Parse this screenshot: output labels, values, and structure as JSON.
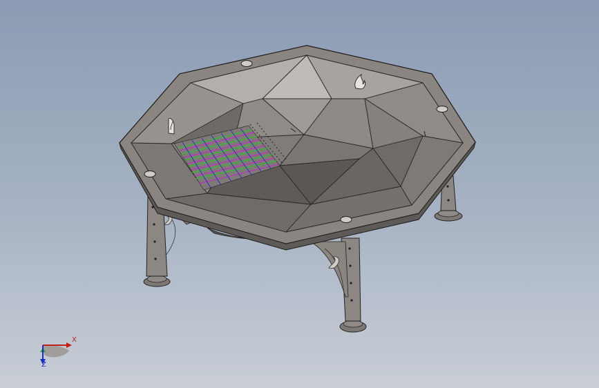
{
  "viewport": {
    "background_top": "#8b9bb3",
    "background_bottom": "#c9ced6"
  },
  "model": {
    "name": "octagonal-fire-pit",
    "body_color": "#8a8580",
    "rim_color": "#6f6a66",
    "line_color": "#2a2826",
    "grid_colors": [
      "#22cc22",
      "#cc22cc",
      "#2222cc"
    ],
    "leg_count": 4,
    "flame_cutouts": true
  },
  "triad": {
    "x_label": "X",
    "z_label": "Z",
    "x_color": "#c0201a",
    "y_color": "#1fae1f",
    "z_color": "#1a2fc0"
  }
}
